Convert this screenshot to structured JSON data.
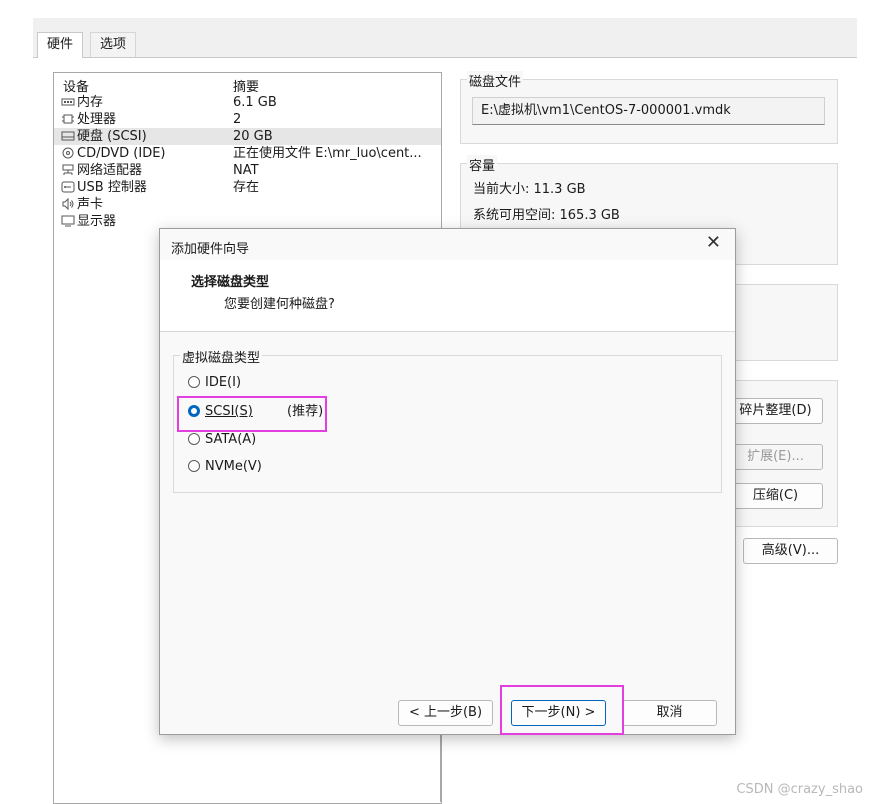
{
  "tabs": [
    {
      "label": "硬件"
    },
    {
      "label": "选项"
    }
  ],
  "device_table": {
    "col_device": "设备",
    "col_summary": "摘要",
    "rows": [
      {
        "name": "内存",
        "summary": "6.1 GB",
        "icon": "memory-icon"
      },
      {
        "name": "处理器",
        "summary": "2",
        "icon": "cpu-icon"
      },
      {
        "name": "硬盘 (SCSI)",
        "summary": "20 GB",
        "icon": "harddisk-icon",
        "selected": true
      },
      {
        "name": "CD/DVD (IDE)",
        "summary": "正在使用文件 E:\\mr_luo\\cent...",
        "icon": "cd-icon"
      },
      {
        "name": "网络适配器",
        "summary": "NAT",
        "icon": "network-icon"
      },
      {
        "name": "USB 控制器",
        "summary": "存在",
        "icon": "usb-icon"
      },
      {
        "name": "声卡",
        "summary": "",
        "icon": "speaker-icon"
      },
      {
        "name": "显示器",
        "summary": "",
        "icon": "monitor-icon"
      }
    ]
  },
  "disk_file": {
    "label": "磁盘文件",
    "path": "E:\\虚拟机\\vm1\\CentOS-7-000001.vmdk"
  },
  "capacity": {
    "label": "容量",
    "current_size": "当前大小: 11.3 GB",
    "available": "系统可用空间: 165.3 GB"
  },
  "side_buttons": {
    "defrag": "碎片整理(D)",
    "expand": "扩展(E)...",
    "compact": "压缩(C)",
    "advanced": "高级(V)..."
  },
  "dialog": {
    "title": "添加硬件向导",
    "close": "✕",
    "heading": "选择磁盘类型",
    "subheading": "您要创建何种磁盘?",
    "group_label": "虚拟磁盘类型",
    "options": [
      {
        "label": "IDE(I)",
        "checked": false
      },
      {
        "label": "SCSI(S)",
        "note": "(推荐)",
        "checked": true
      },
      {
        "label": "SATA(A)",
        "checked": false
      },
      {
        "label": "NVMe(V)",
        "checked": false
      }
    ],
    "buttons": {
      "back": "< 上一步(B)",
      "next": "下一步(N) >",
      "cancel": "取消"
    }
  },
  "watermark": "CSDN @crazy_shao",
  "colors": {
    "highlight": "#e23ee0",
    "radio_accent": "#0067c0"
  }
}
